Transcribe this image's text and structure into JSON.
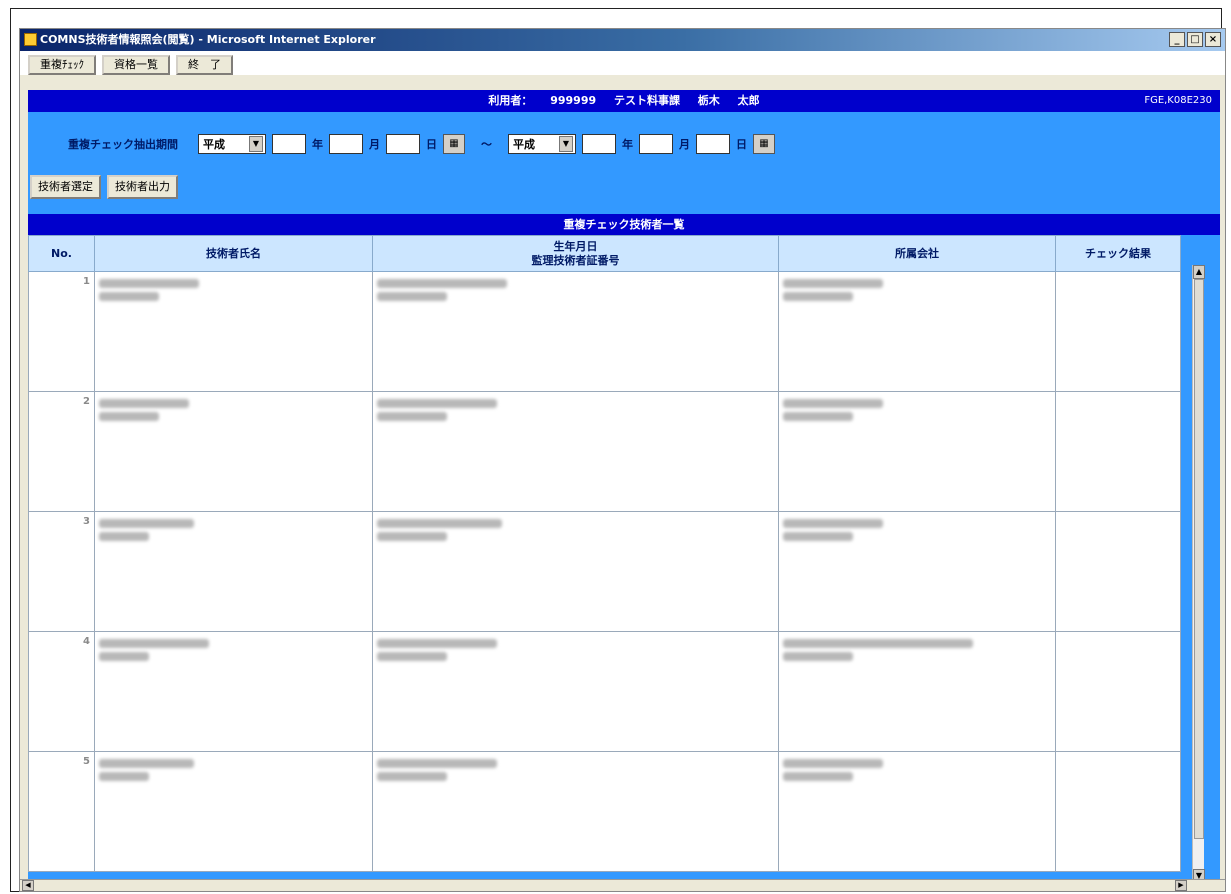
{
  "window": {
    "title": "COMNS技術者情報照会(閲覧) - Microsoft Internet Explorer",
    "minimize": "_",
    "maximize": "□",
    "close": "×"
  },
  "toolbar": {
    "btn1": "重複ﾁｪｯｸ",
    "btn2": "資格一覧",
    "btn3": "終　了"
  },
  "user_bar": {
    "center": "利用者： 999999 テスト料事課 栃木 太郎",
    "right": "FGE,K08E230"
  },
  "search": {
    "label": "重複チェック抽出期間",
    "era_from": "平成",
    "era_to": "平成",
    "unit_year": "年",
    "unit_month": "月",
    "unit_day": "日",
    "tilde": "～",
    "cal_icon": "▦"
  },
  "actions": {
    "btn_search": "技術者選定",
    "btn_output": "技術者出力"
  },
  "list": {
    "title": "重複チェック技術者一覧",
    "headers": {
      "no": "No.",
      "name": "技術者氏名",
      "birth_line1": "生年月日",
      "birth_line2": "監理技術者証番号",
      "company": "所属会社",
      "result": "チェック結果"
    },
    "rows": [
      {
        "no": "1"
      },
      {
        "no": "2"
      },
      {
        "no": "3"
      },
      {
        "no": "4"
      },
      {
        "no": "5"
      }
    ]
  },
  "scroll": {
    "up": "▲",
    "down": "▼",
    "left": "◀",
    "right": "▶"
  }
}
